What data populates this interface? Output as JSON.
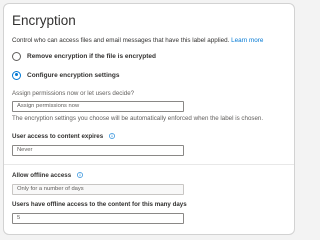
{
  "encryption": {
    "title": "Encryption",
    "description": "Control who can access files and email messages that have this label applied.",
    "learn_more": "Learn more",
    "options": [
      {
        "label": "Remove encryption if the file is encrypted",
        "selected": false
      },
      {
        "label": "Configure encryption settings",
        "selected": true
      }
    ],
    "assign_question": "Assign permissions now or let users decide?",
    "assign_value": "Assign permissions now",
    "assign_hint": "The encryption settings you choose will be automatically enforced when the label is chosen.",
    "expires_label": "User access to content expires",
    "expires_value": "Never",
    "offline_label": "Allow offline access",
    "offline_value": "Only for a number of days",
    "days_label": "Users have offline access to the content for this many days",
    "days_value": "5"
  },
  "colors": {
    "accent": "#0078d4",
    "text": "#323130",
    "muted": "#605e5c",
    "border": "#8a8886"
  },
  "icons": {
    "info": "info-circle-icon"
  }
}
